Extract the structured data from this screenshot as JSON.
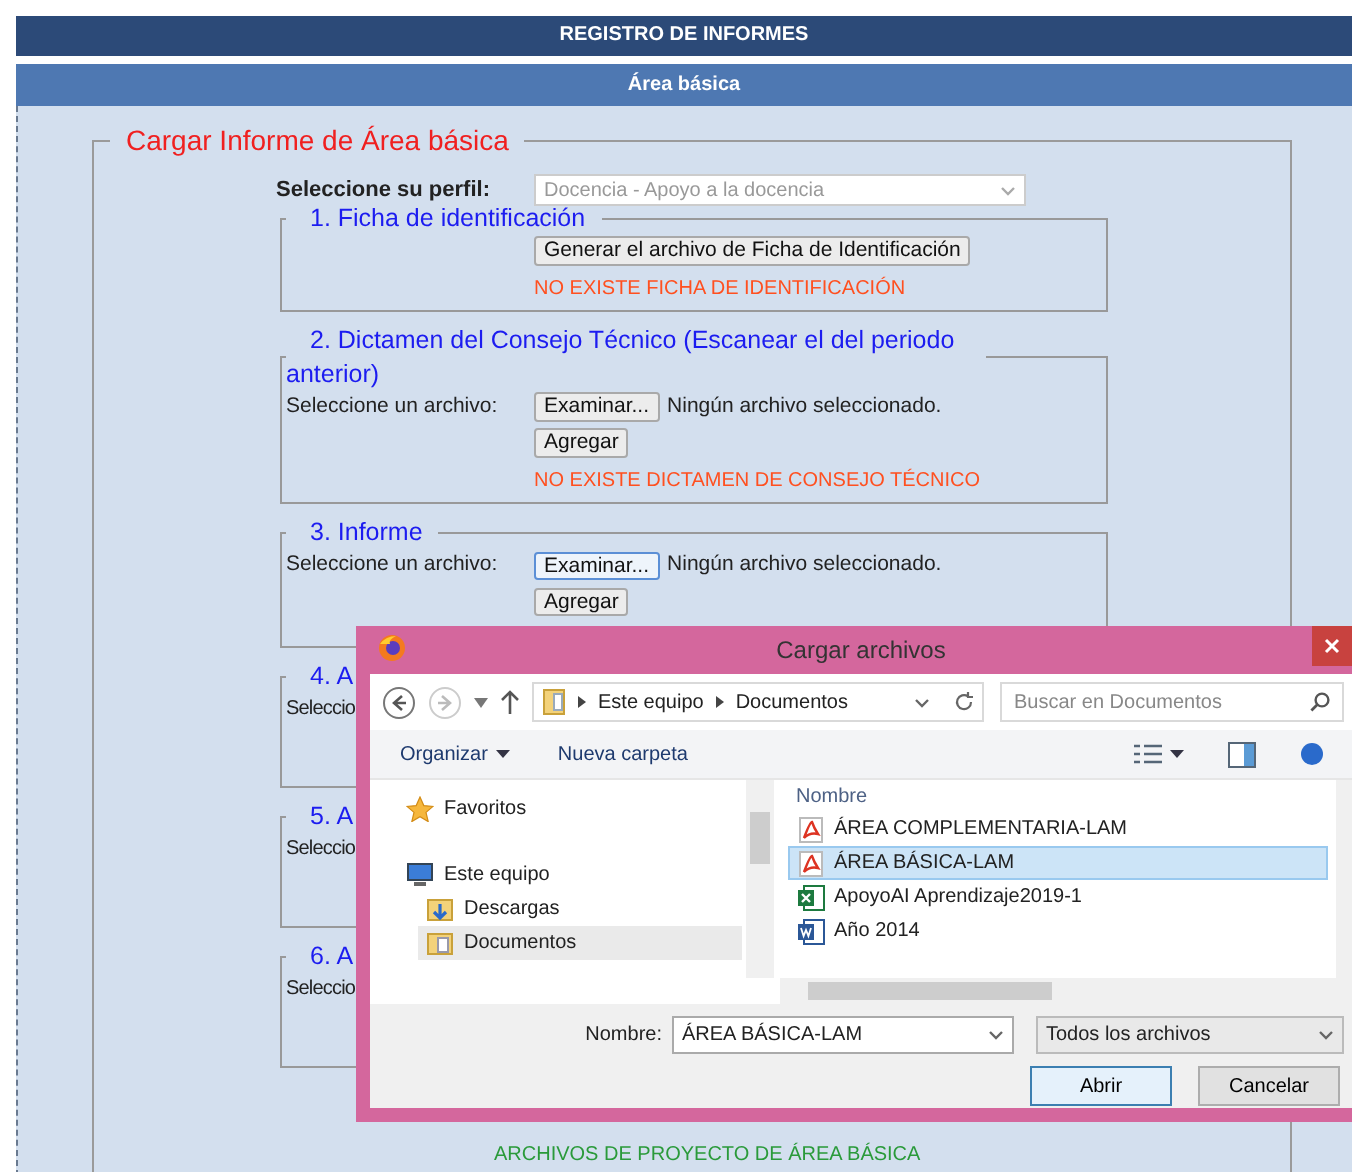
{
  "header": {
    "title": "REGISTRO DE INFORMES"
  },
  "subheader": {
    "title": "Área básica"
  },
  "form": {
    "legend": "Cargar Informe de Área básica",
    "profile": {
      "label": "Seleccione su perfil:",
      "value": "Docencia - Apoyo a la docencia",
      "disabled": true
    },
    "sections": [
      {
        "kind": "generate",
        "title": "1. Ficha de identificación",
        "button": "Generar el archivo de Ficha de Identificación",
        "message": "NO EXISTE FICHA DE IDENTIFICACIÓN"
      },
      {
        "kind": "upload",
        "title": "2. Dictamen del Consejo Técnico (Escanear el del periodo anterior)",
        "file_label": "Seleccione un archivo:",
        "browse": "Examinar...",
        "focused": false,
        "file_status": "Ningún archivo seleccionado.",
        "add": "Agregar",
        "message": "NO EXISTE DICTAMEN DE CONSEJO TÉCNICO"
      },
      {
        "kind": "upload",
        "title": "3. Informe",
        "file_label": "Seleccione un archivo:",
        "browse": "Examinar...",
        "focused": true,
        "file_status": "Ningún archivo seleccionado.",
        "add": "Agregar"
      },
      {
        "kind": "partial",
        "title": "4. A",
        "file_label": "Seleccio"
      },
      {
        "kind": "partial",
        "title": "5. A",
        "file_label": "Seleccio"
      },
      {
        "kind": "partial",
        "title": "6. A",
        "file_label": "Seleccio"
      }
    ],
    "footer_note": "ARCHIVOS DE PROYECTO DE ÁREA BÁSICA"
  },
  "dialog": {
    "title": "Cargar archivos",
    "breadcrumb": [
      "Este equipo",
      "Documentos"
    ],
    "search": {
      "placeholder": "Buscar en Documentos"
    },
    "toolbar": [
      {
        "label": "Organizar",
        "menu": true
      },
      {
        "label": "Nueva carpeta",
        "menu": false
      }
    ],
    "nav_pane": [
      {
        "label": "Favoritos",
        "kind": "favorites",
        "selected": false
      },
      {
        "label": "Este equipo",
        "kind": "computer",
        "selected": false,
        "children": [
          {
            "label": "Descargas",
            "kind": "downloads",
            "selected": false
          },
          {
            "label": "Documentos",
            "kind": "folder",
            "selected": true
          }
        ]
      }
    ],
    "column": "Nombre",
    "files": [
      {
        "name": "ÁREA COMPLEMENTARIA-LAM",
        "kind": "pdf",
        "selected": false
      },
      {
        "name": "ÁREA BÁSICA-LAM",
        "kind": "pdf",
        "selected": true
      },
      {
        "name": "ApoyoAI Aprendizaje2019-1",
        "kind": "excel",
        "selected": false
      },
      {
        "name": "Año 2014",
        "kind": "word",
        "selected": false
      }
    ],
    "filename": {
      "label": "Nombre:",
      "value": "ÁREA BÁSICA-LAM"
    },
    "filter": "Todos los archivos",
    "buttons": [
      {
        "label": "Abrir",
        "default": true
      },
      {
        "label": "Cancelar",
        "default": false
      }
    ]
  }
}
